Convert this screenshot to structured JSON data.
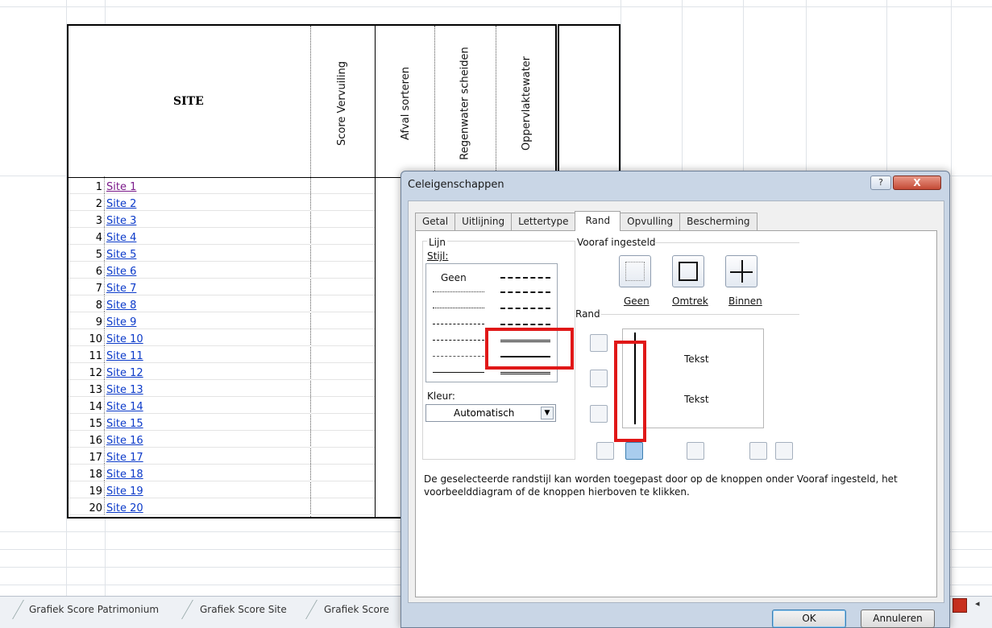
{
  "sheet": {
    "site_header": "SITE",
    "rotated_headers": [
      "Score Vervuiling",
      "Afval sorteren",
      "Regenwater scheiden",
      "Oppervlaktewater"
    ],
    "rows": [
      {
        "num": "1",
        "site": "Site 1"
      },
      {
        "num": "2",
        "site": "Site 2"
      },
      {
        "num": "3",
        "site": "Site 3"
      },
      {
        "num": "4",
        "site": "Site 4"
      },
      {
        "num": "5",
        "site": "Site 5"
      },
      {
        "num": "6",
        "site": "Site 6"
      },
      {
        "num": "7",
        "site": "Site 7"
      },
      {
        "num": "8",
        "site": "Site 8"
      },
      {
        "num": "9",
        "site": "Site 9"
      },
      {
        "num": "10",
        "site": "Site 10"
      },
      {
        "num": "11",
        "site": "Site 11"
      },
      {
        "num": "12",
        "site": "Site 12"
      },
      {
        "num": "13",
        "site": "Site 13"
      },
      {
        "num": "14",
        "site": "Site 14"
      },
      {
        "num": "15",
        "site": "Site 15"
      },
      {
        "num": "16",
        "site": "Site 16"
      },
      {
        "num": "17",
        "site": "Site 17"
      },
      {
        "num": "18",
        "site": "Site 18"
      },
      {
        "num": "19",
        "site": "Site 19"
      },
      {
        "num": "20",
        "site": "Site 20"
      }
    ],
    "tabs": [
      "Grafiek Score Patrimonium",
      "Grafiek Score Site",
      "Grafiek Score"
    ]
  },
  "dialog": {
    "title": "Celeigenschappen",
    "help": "?",
    "close": "X",
    "tabs": [
      "Getal",
      "Uitlijning",
      "Lettertype",
      "Rand",
      "Opvulling",
      "Bescherming"
    ],
    "active_tab": "Rand",
    "line_group": "Lijn",
    "style_label": "Stijl:",
    "style_none": "Geen",
    "color_label": "Kleur:",
    "color_value": "Automatisch",
    "preset_group": "Vooraf ingesteld",
    "presets": [
      "Geen",
      "Omtrek",
      "Binnen"
    ],
    "border_group": "Rand",
    "preview_text": [
      "Tekst",
      "Tekst"
    ],
    "description": "De geselecteerde randstijl kan worden toegepast door op de knoppen onder Vooraf ingesteld, het voorbeelddiagram of de knoppen hierboven te klikken.",
    "ok": "OK",
    "cancel": "Annuleren",
    "highlight_color": "#e01818"
  }
}
